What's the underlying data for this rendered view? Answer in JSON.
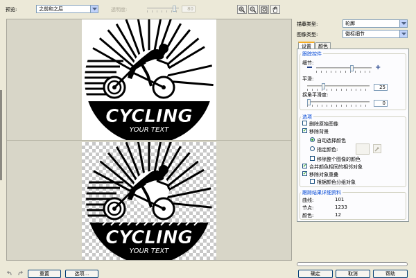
{
  "toolbar": {
    "preview_label": "预览:",
    "preview_value": "之前和之后",
    "transparency_label": "透明度:",
    "transparency_value": "80",
    "icons": [
      "zoom-in-icon",
      "zoom-out-icon",
      "fit-view-icon",
      "pan-hand-icon"
    ]
  },
  "right_panel": {
    "trace_type_label": "描摹类型:",
    "trace_type_value": "轮廓",
    "image_type_label": "图像类型:",
    "image_type_value": "徽标细节",
    "tabs": [
      {
        "label": "设置"
      },
      {
        "label": "颜色"
      }
    ],
    "trace_controls": {
      "title": "跟踪控件",
      "detail_label": "细节:",
      "detail_level": 0.65,
      "smoothing_label": "平滑:",
      "smoothing_value": "25",
      "smoothing_level": 0.25,
      "corner_label": "拐角平滑度:",
      "corner_value": "0",
      "corner_level": 0.0
    },
    "options": {
      "title": "选项",
      "delete_original": {
        "label": "删除原始图像",
        "checked": false
      },
      "remove_background": {
        "label": "移除背景",
        "checked": true
      },
      "auto_color": {
        "label": "自动选择颜色",
        "selected": true
      },
      "specify_color": {
        "label": "指定颜色:",
        "selected": false
      },
      "remove_entire_color": {
        "label": "移除整个图像的颜色",
        "checked": false
      },
      "merge_adjacent": {
        "label": "合并颜色相同的相邻对象",
        "checked": true
      },
      "remove_overlap": {
        "label": "移除对象重叠",
        "checked": true
      },
      "group_by_color": {
        "label": "根据颜色分组对象",
        "checked": false
      }
    },
    "trace_results": {
      "title": "跟踪结果详细资料",
      "rows": [
        {
          "label": "曲线:",
          "value": "101"
        },
        {
          "label": "节点:",
          "value": "1233"
        },
        {
          "label": "颜色:",
          "value": "12"
        }
      ]
    }
  },
  "bottom": {
    "reset_label": "重置",
    "options_label": "选项...",
    "ok_label": "确定",
    "cancel_label": "取消",
    "help_label": "帮助"
  },
  "artwork": {
    "logo_text": "CYCLING",
    "logo_subtext": "YOUR TEXT"
  }
}
